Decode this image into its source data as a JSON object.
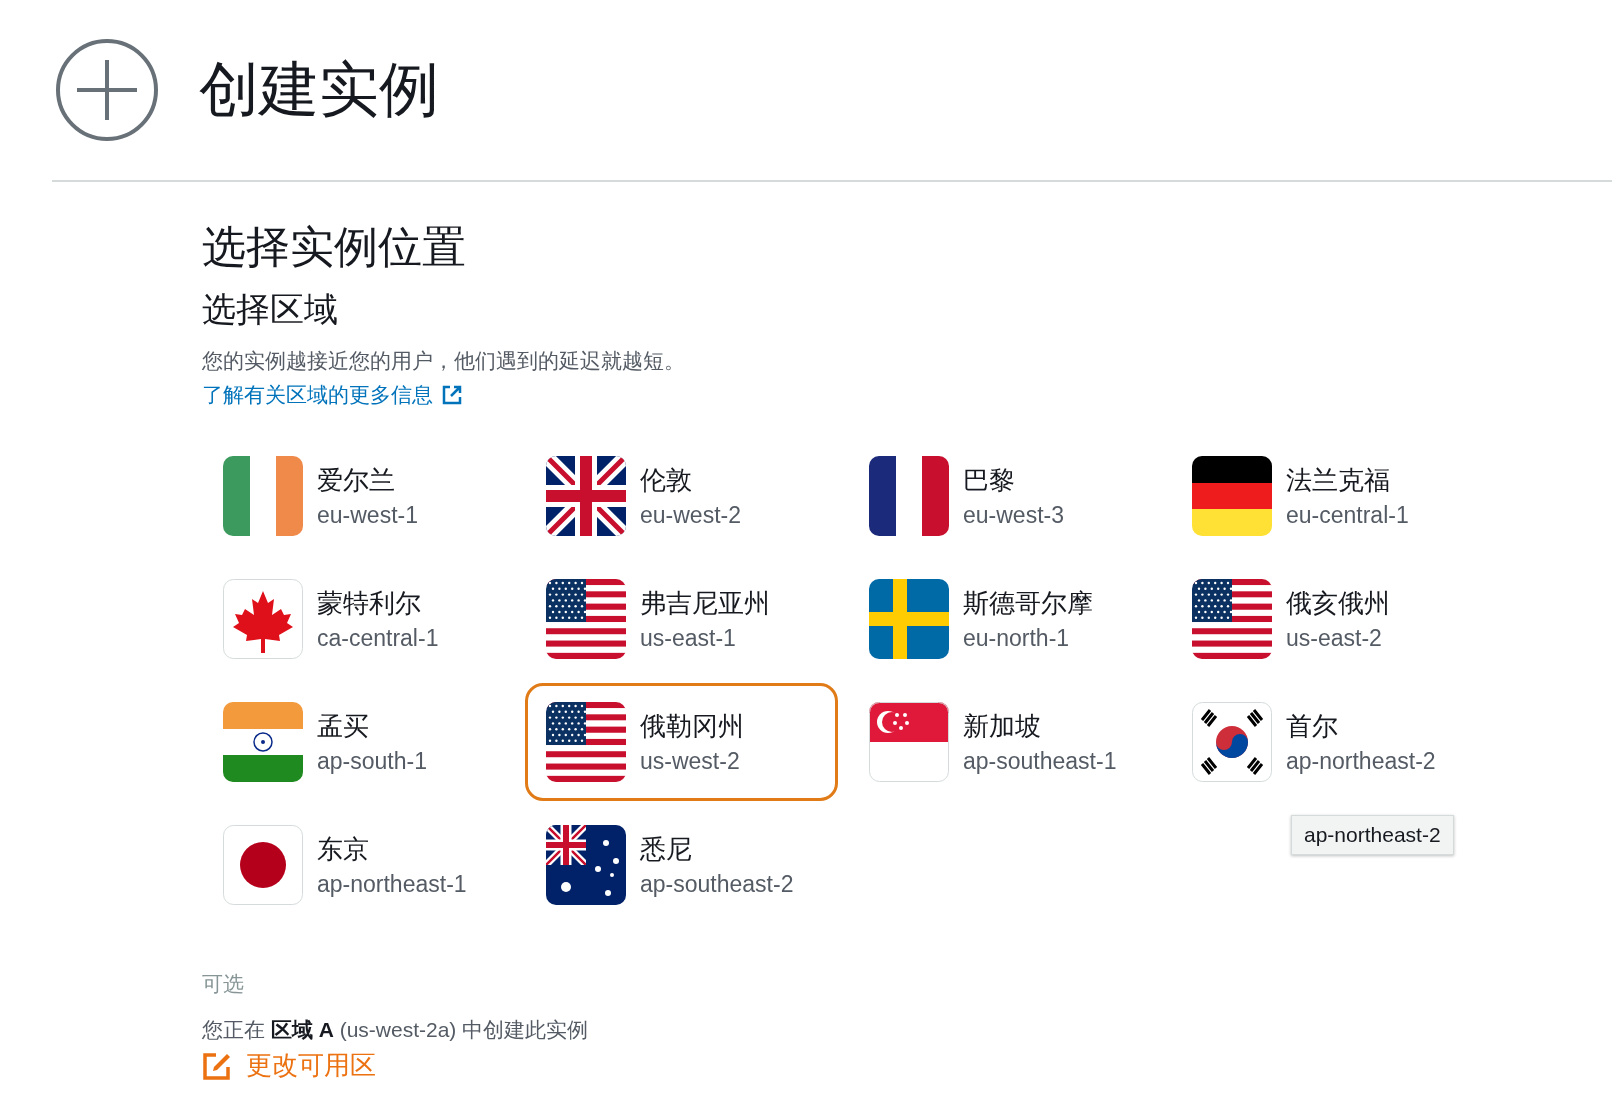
{
  "header": {
    "title": "创建实例"
  },
  "location": {
    "heading": "选择实例位置",
    "subheading": "选择区域",
    "description": "您的实例越接近您的用户，他们遇到的延迟就越短。",
    "learn_more_link": "了解有关区域的更多信息"
  },
  "regions": [
    {
      "name": "爱尔兰",
      "code": "eu-west-1",
      "kind": "ireland",
      "selected": false
    },
    {
      "name": "伦敦",
      "code": "eu-west-2",
      "kind": "uk",
      "selected": false
    },
    {
      "name": "巴黎",
      "code": "eu-west-3",
      "kind": "france",
      "selected": false
    },
    {
      "name": "法兰克福",
      "code": "eu-central-1",
      "kind": "germany",
      "selected": false
    },
    {
      "name": "蒙特利尔",
      "code": "ca-central-1",
      "kind": "canada",
      "selected": false
    },
    {
      "name": "弗吉尼亚州",
      "code": "us-east-1",
      "kind": "usa",
      "selected": false
    },
    {
      "name": "斯德哥尔摩",
      "code": "eu-north-1",
      "kind": "sweden",
      "selected": false
    },
    {
      "name": "俄亥俄州",
      "code": "us-east-2",
      "kind": "usa",
      "selected": false
    },
    {
      "name": "孟买",
      "code": "ap-south-1",
      "kind": "india",
      "selected": false
    },
    {
      "name": "俄勒冈州",
      "code": "us-west-2",
      "kind": "usa",
      "selected": true
    },
    {
      "name": "新加坡",
      "code": "ap-southeast-1",
      "kind": "singapore",
      "selected": false
    },
    {
      "name": "首尔",
      "code": "ap-northeast-2",
      "kind": "korea",
      "selected": false,
      "tooltip": "ap-northeast-2"
    },
    {
      "name": "东京",
      "code": "ap-northeast-1",
      "kind": "japan",
      "selected": false
    },
    {
      "name": "悉尼",
      "code": "ap-southeast-2",
      "kind": "australia",
      "selected": false
    }
  ],
  "availability_zone": {
    "label": "可选",
    "text": "您正在 **区域 A** (us-west-2a) 中创建此实例",
    "change_link": "更改可用区"
  }
}
